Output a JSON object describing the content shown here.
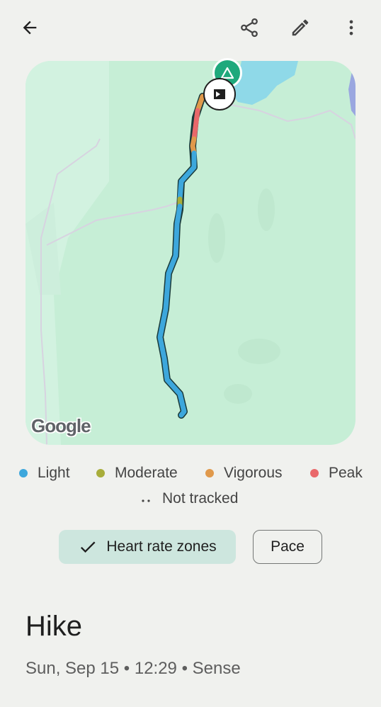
{
  "header": {
    "back_icon": "arrow-back-icon",
    "share_icon": "share-icon",
    "edit_icon": "pencil-edit-icon",
    "more_icon": "more-vert-icon"
  },
  "map": {
    "attribution": "Google",
    "start_icon": "tent-icon",
    "finish_icon": "flag-icon"
  },
  "legend": {
    "items": [
      {
        "label": "Light",
        "color": "#3da7dc"
      },
      {
        "label": "Moderate",
        "color": "#a8ad3a"
      },
      {
        "label": "Vigorous",
        "color": "#e0994b"
      },
      {
        "label": "Peak",
        "color": "#e9686a"
      }
    ],
    "not_tracked": "Not tracked"
  },
  "chips": {
    "heart_rate": "Heart rate zones",
    "pace": "Pace"
  },
  "activity": {
    "title": "Hike",
    "subtitle": "Sun, Sep 15 • 12:29 • Sense"
  }
}
